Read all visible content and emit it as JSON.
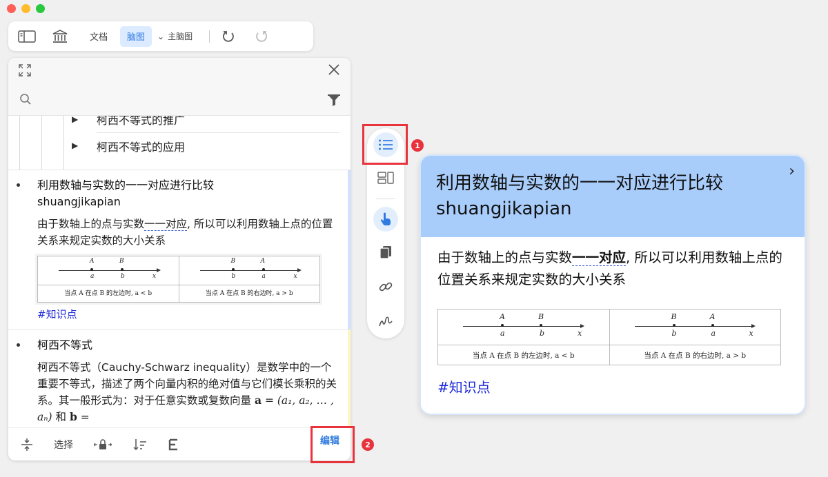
{
  "toolbar": {
    "doc_label": "文档",
    "mindmap_label": "脑图",
    "main_map_label": "主脑图"
  },
  "panel": {
    "search_placeholder": "",
    "tree_nodes": [
      "柯西不等式的推广",
      "柯西不等式的应用"
    ],
    "cards": [
      {
        "title_line1": "利用数轴与实数的一一对应进行比较",
        "title_line2": "shuangjikapian",
        "body_pre": "由于数轴上的点与实数",
        "body_link": "一一对应",
        "body_post": ", 所以可以利用数轴上点的位置关系来规定实数的大小关系",
        "tag": "#知识点"
      },
      {
        "title": "柯西不等式",
        "body": "柯西不等式（Cauchy-Schwarz inequality）是数学中的一个重要不等式，描述了两个向量内积的绝对值与它们模长乘积的关系。其一般形式为：对于任意实数或复数向量",
        "formula_a": "a",
        "formula_a_value": "= (a₁, a₂, … , aₙ)",
        "formula_and": "和",
        "formula_b": "b",
        "formula_b_eq": "="
      }
    ],
    "footer": {
      "select_label": "选择",
      "edit_label": "编辑"
    }
  },
  "figure": {
    "left": {
      "pt1_up": "A",
      "pt1_dn": "a",
      "pt2_up": "B",
      "pt2_dn": "b",
      "axis": "x",
      "caption": "当点 A 在点 B 的左边时, a < b"
    },
    "right": {
      "pt1_up": "B",
      "pt1_dn": "b",
      "pt2_up": "A",
      "pt2_dn": "a",
      "axis": "x",
      "caption": "当点 A 在点 B 的右边时, a > b"
    }
  },
  "preview": {
    "title_line1": "利用数轴与实数的一一对应进行比较",
    "title_line2": "shuangjikapian",
    "body_pre": "由于数轴上的点与实数",
    "body_link": "一一对应",
    "body_post": ", 所以可以利用数轴上点的位置关系来规定实数的大小关系",
    "tag": "#知识点"
  },
  "annotations": {
    "badge1": "1",
    "badge2": "2"
  }
}
